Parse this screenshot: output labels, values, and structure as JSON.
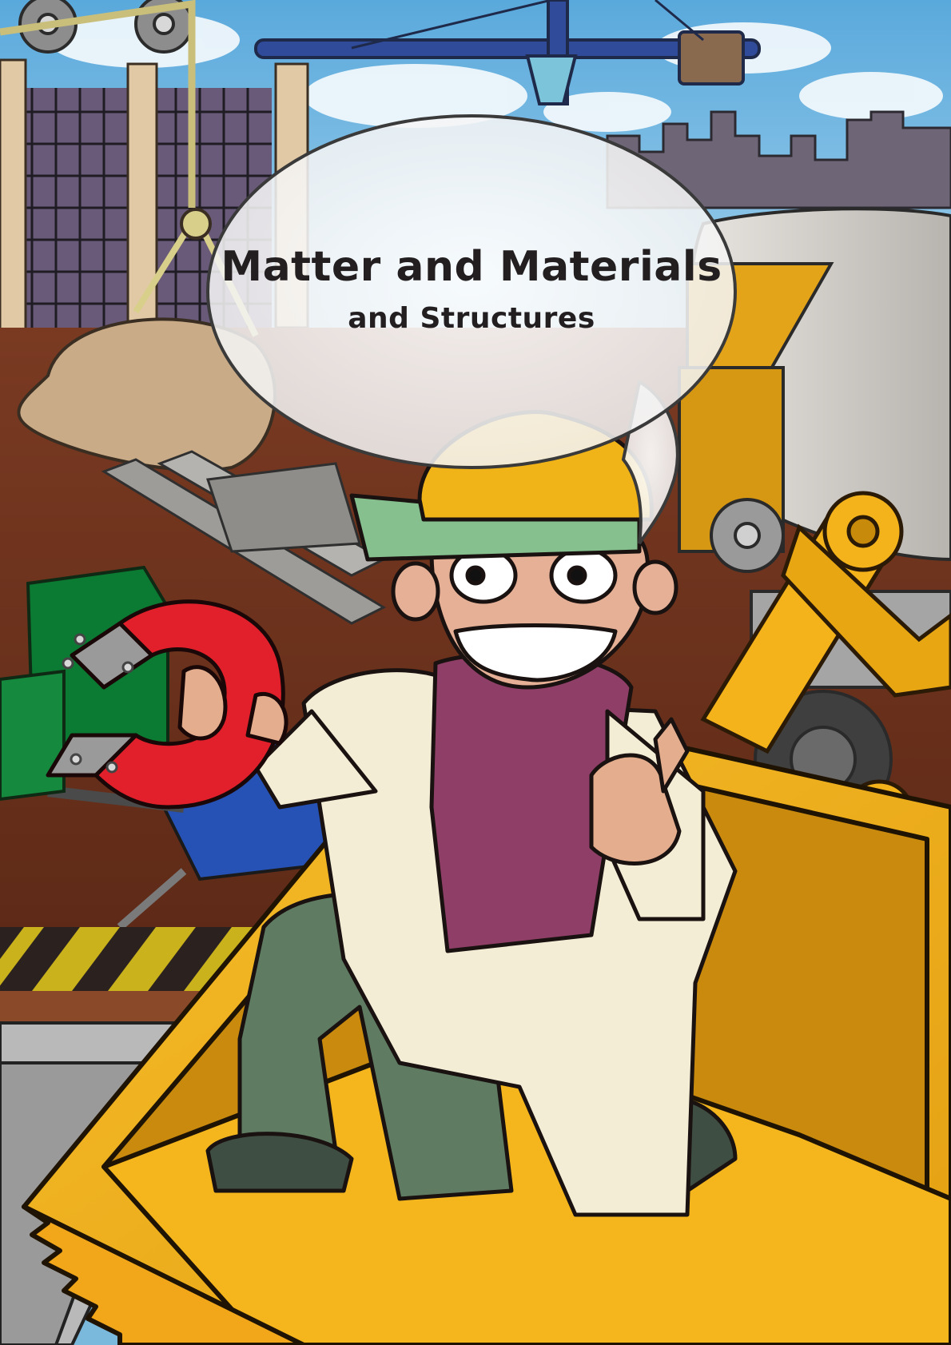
{
  "cover": {
    "title": "Matter and Materials",
    "subtitle": "and Structures"
  },
  "scene": {
    "setting": "construction site",
    "elements": [
      "crane",
      "city-skyline",
      "scaffolding",
      "sandbags",
      "steel-beams",
      "cement-mixer",
      "excavator-bucket",
      "wheelbarrow",
      "caution-stripe",
      "horseshoe-magnet",
      "boy-scientist"
    ]
  },
  "colors": {
    "sky": "#7ab8dc",
    "excavator_yellow": "#f4b21b",
    "magnet_red": "#e2202b",
    "helmet_yellow": "#f1b418",
    "hoodie": "#8f3f67",
    "pants": "#5f7c63",
    "lab_coat": "#f4edd5",
    "text": "#231f20"
  }
}
